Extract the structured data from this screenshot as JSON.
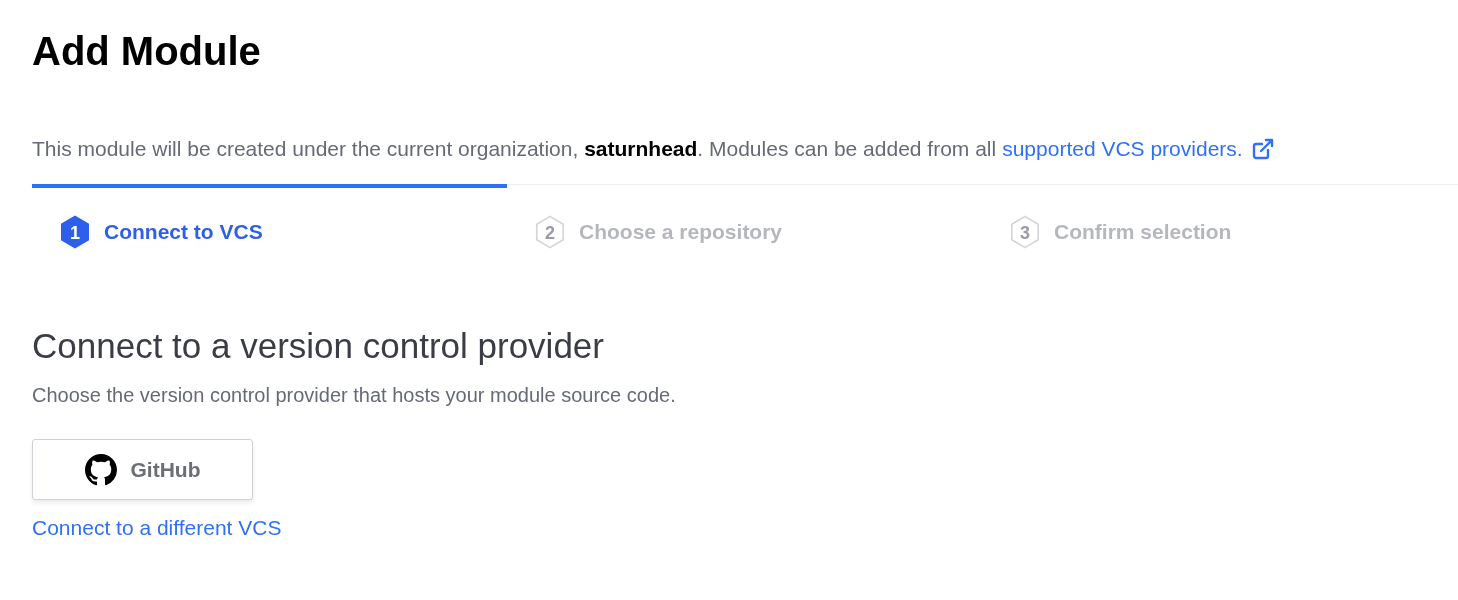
{
  "title": "Add Module",
  "intro": {
    "text": "This module will be created under the current organization, **saturnhead**. Modules can be added from all ",
    "link": "supported VCS providers."
  },
  "steps": [
    {
      "number": "1",
      "label": "Connect to VCS",
      "selected": true
    },
    {
      "number": "2",
      "label": "Choose a repository",
      "selected": false
    },
    {
      "number": "3",
      "label": "Confirm selection",
      "selected": false
    }
  ],
  "section": {
    "heading": "Connect to a version control provider",
    "description": "Choose the version control provider that hosts your module source code."
  },
  "providers": [
    {
      "label": "GitHub"
    }
  ],
  "alt_link": "Connect to a different VCS"
}
